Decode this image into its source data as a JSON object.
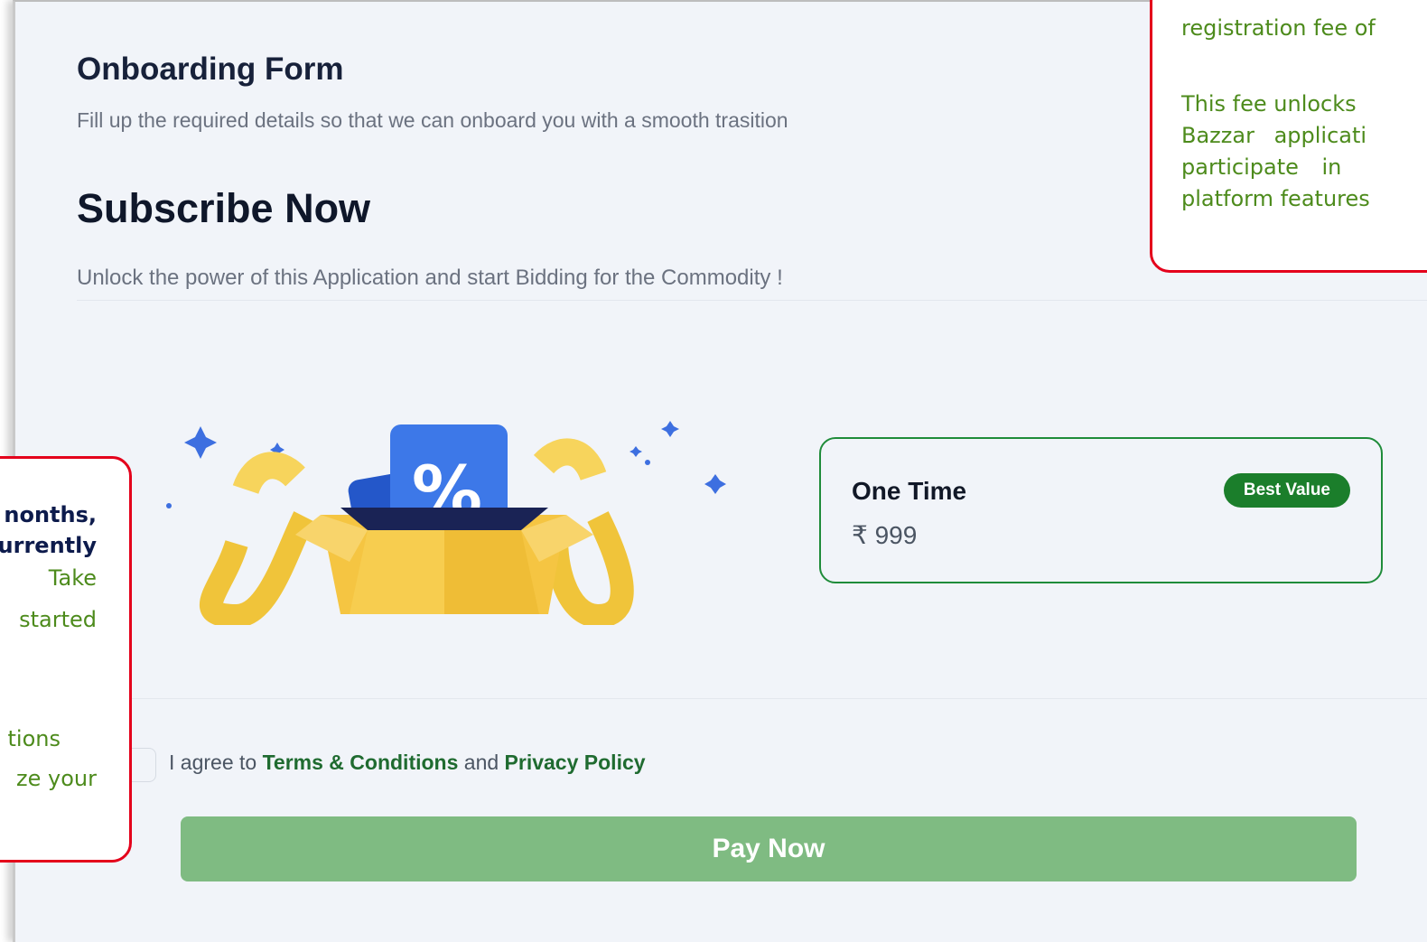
{
  "page": {
    "title": "Onboarding Form",
    "subtitle": "Fill up the required details so that we can onboard you with a smooth trasition",
    "subscribe_heading": "Subscribe Now",
    "subscribe_desc": "Unlock the power of this Application and start Bidding for the Commodity !"
  },
  "plan": {
    "name": "One Time",
    "price": "₹ 999",
    "badge": "Best Value"
  },
  "agreement": {
    "prefix": "I agree to",
    "terms": "Terms & Conditions",
    "and": "and",
    "privacy": "Privacy Policy"
  },
  "pay_button": "Pay Now",
  "callout_top": {
    "lines": [
      "registration fee of",
      "This fee unlocks",
      "Bazzar applicati",
      "participate in",
      "platform features"
    ]
  },
  "callout_left": {
    "lines": [
      "nonths,",
      "urrently",
      "Take",
      "started",
      "tions",
      "ze your"
    ]
  },
  "colors": {
    "accent_green": "#1b7e2b",
    "button_green": "#7fbb82",
    "callout_red": "#e4001b",
    "callout_text_green": "#4d8b1c",
    "callout_text_navy": "#0d1b4c"
  },
  "icons": {
    "illustration": "gift-box-discount-icon",
    "sparkle": "sparkle-icon"
  }
}
